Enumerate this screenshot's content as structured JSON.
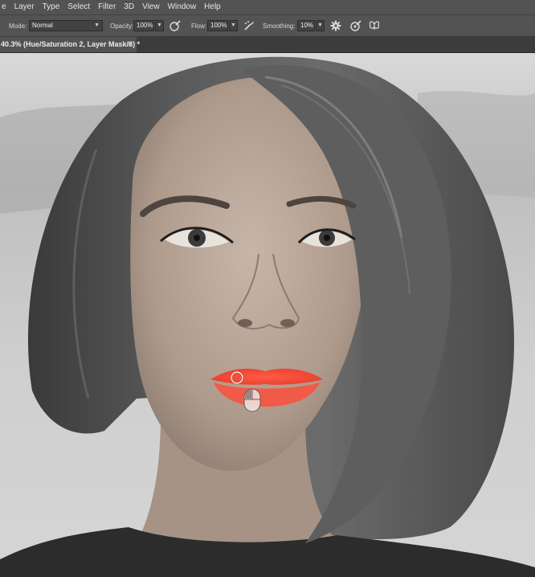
{
  "menu": [
    "e",
    "Layer",
    "Type",
    "Select",
    "Filter",
    "3D",
    "View",
    "Window",
    "Help"
  ],
  "options": {
    "mode_label": "Mode:",
    "mode_value": "Normal",
    "opacity_label": "Opacity:",
    "opacity_value": "100%",
    "flow_label": "Flow:",
    "flow_value": "100%",
    "smoothing_label": "Smoothing:",
    "smoothing_value": "10%"
  },
  "document_tab": {
    "title": "40.3% (Hue/Saturation 2, Layer Mask/8) *",
    "close": "×"
  },
  "icons": {
    "chevron": "chevron-down-icon",
    "pressure_opacity": "pressure-opacity-icon",
    "airbrush": "airbrush-icon",
    "smoothing_settings": "gear-icon",
    "pressure_size": "pressure-size-icon",
    "symmetry": "butterfly-symmetry-icon"
  },
  "colors": {
    "ui_panel": "#535353",
    "tab_bar": "#3c3c3c",
    "lip_color": "#f04535"
  }
}
